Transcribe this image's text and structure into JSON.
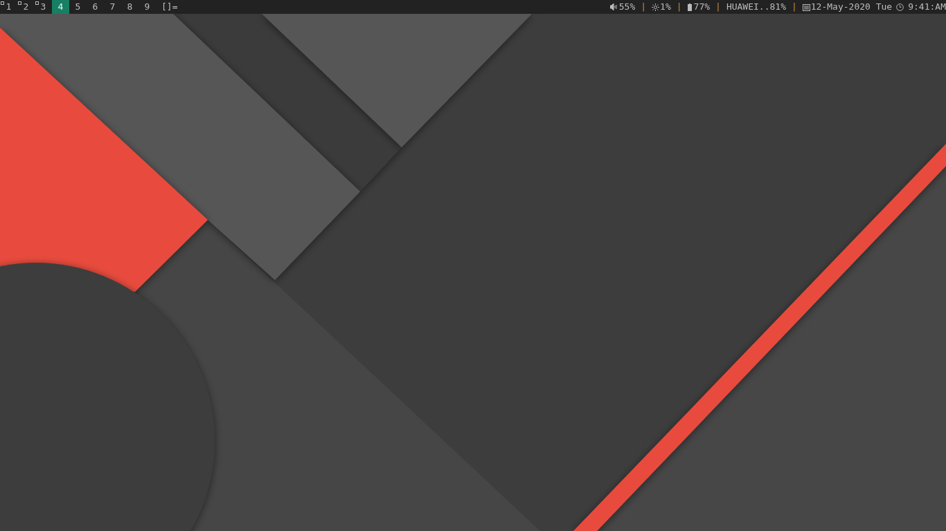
{
  "bar": {
    "tags": [
      {
        "label": "1",
        "selected": false,
        "occupied": true
      },
      {
        "label": "2",
        "selected": false,
        "occupied": true
      },
      {
        "label": "3",
        "selected": false,
        "occupied": true
      },
      {
        "label": "4",
        "selected": true,
        "occupied": false
      },
      {
        "label": "5",
        "selected": false,
        "occupied": false
      },
      {
        "label": "6",
        "selected": false,
        "occupied": false
      },
      {
        "label": "7",
        "selected": false,
        "occupied": false
      },
      {
        "label": "8",
        "selected": false,
        "occupied": false
      },
      {
        "label": "9",
        "selected": false,
        "occupied": false
      }
    ],
    "layout": "[]=",
    "status": [
      {
        "kind": "volume",
        "text": "55%"
      },
      {
        "kind": "separator",
        "text": "|"
      },
      {
        "kind": "brightness",
        "text": "1%"
      },
      {
        "kind": "separator",
        "text": "|"
      },
      {
        "kind": "battery",
        "text": "77%"
      },
      {
        "kind": "separator",
        "text": "|"
      },
      {
        "kind": "wifi",
        "text": "HUAWEI..81%"
      },
      {
        "kind": "separator",
        "text": "|"
      },
      {
        "kind": "date",
        "text": "12-May-2020 Tue"
      },
      {
        "kind": "time",
        "text": "9:41:AM"
      }
    ]
  }
}
